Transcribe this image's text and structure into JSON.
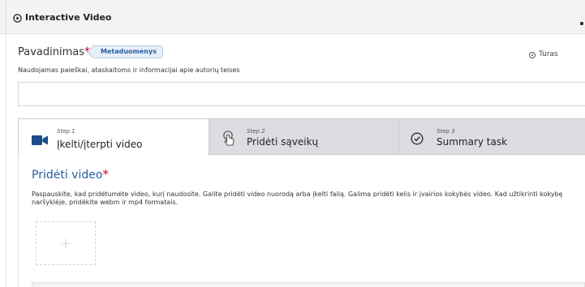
{
  "header": {
    "title": "Interactive Video",
    "icon": "play-circle-icon"
  },
  "title_field": {
    "label": "Pavadinimas",
    "required_mark": "*",
    "badge": "Metaduomenys",
    "description": "Naudojamas paieškai, ataskaitoms ir informacijai apie autorių teises",
    "value": "",
    "placeholder": ""
  },
  "tour": {
    "label": "Turas",
    "icon": "tour-icon"
  },
  "tabs": [
    {
      "step": "Step 1",
      "label": "Įkelti/įterpti video",
      "icon": "video-camera-icon",
      "active": true
    },
    {
      "step": "Step 2",
      "label": "Pridėti sąveikų",
      "icon": "hand-pointer-icon",
      "active": false
    },
    {
      "step": "Step 3",
      "label": "Summary task",
      "icon": "check-circle-icon",
      "active": false
    }
  ],
  "video_section": {
    "title": "Pridėti video",
    "required_mark": "*",
    "description": "Paspauskite, kad pridėtumėte video, kurį naudosite. Galite pridėti video nuorodą arba įkelti failą. Galima pridėti kelis ir įvairios kokybės video. Kad užtikrinti kokybę naršyklėje, pridėkite webm ir mp4 formatais.",
    "add_symbol": "+"
  },
  "colors": {
    "accent": "#2a5d9f",
    "required": "#d0021b",
    "tab_inactive": "#dcdde0",
    "header_bg": "#f2f3f5"
  }
}
